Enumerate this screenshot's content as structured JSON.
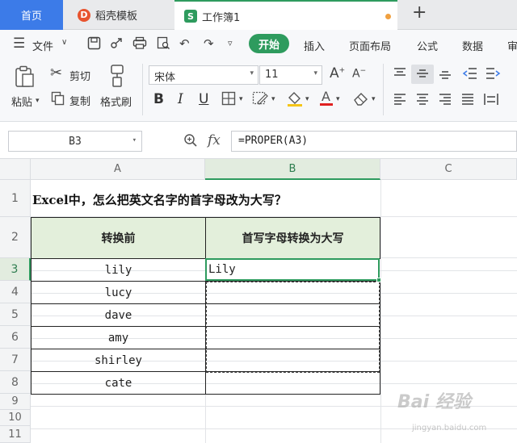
{
  "tabs": {
    "home": "首页",
    "template": "稻壳模板",
    "workbook": "工作簿1",
    "template_logo": "D",
    "workbook_logo": "S",
    "add": "+"
  },
  "menu": {
    "file": "文件",
    "items": [
      "开始",
      "插入",
      "页面布局",
      "公式",
      "数据",
      "审"
    ]
  },
  "ribbon": {
    "paste": "粘贴",
    "cut": "剪切",
    "copy": "复制",
    "format_painter": "格式刷",
    "font_name": "宋体",
    "font_size": "11",
    "bold": "B",
    "italic": "I",
    "underline": "U"
  },
  "formula_bar": {
    "name_box": "B3",
    "fx": "fx",
    "formula": "=PROPER(A3)"
  },
  "sheet": {
    "columns": [
      "A",
      "B",
      "C"
    ],
    "rows": [
      "1",
      "2",
      "3",
      "4",
      "5",
      "6",
      "7",
      "8",
      "9",
      "10",
      "11"
    ],
    "title": "Excel中，怎么把英文名字的首字母改为大写？",
    "header_a": "转换前",
    "header_b": "首写字母转换为大写",
    "names": [
      "lily",
      "lucy",
      "dave",
      "amy",
      "shirley",
      "cate"
    ],
    "b3_value": "Lily"
  },
  "colors": {
    "accent": "#2e9b5e",
    "home_tab": "#3c7be8",
    "header_fill": "#e3efdb"
  },
  "watermark": {
    "logo": "Bai 经验",
    "url": "jingyan.baidu.com"
  }
}
